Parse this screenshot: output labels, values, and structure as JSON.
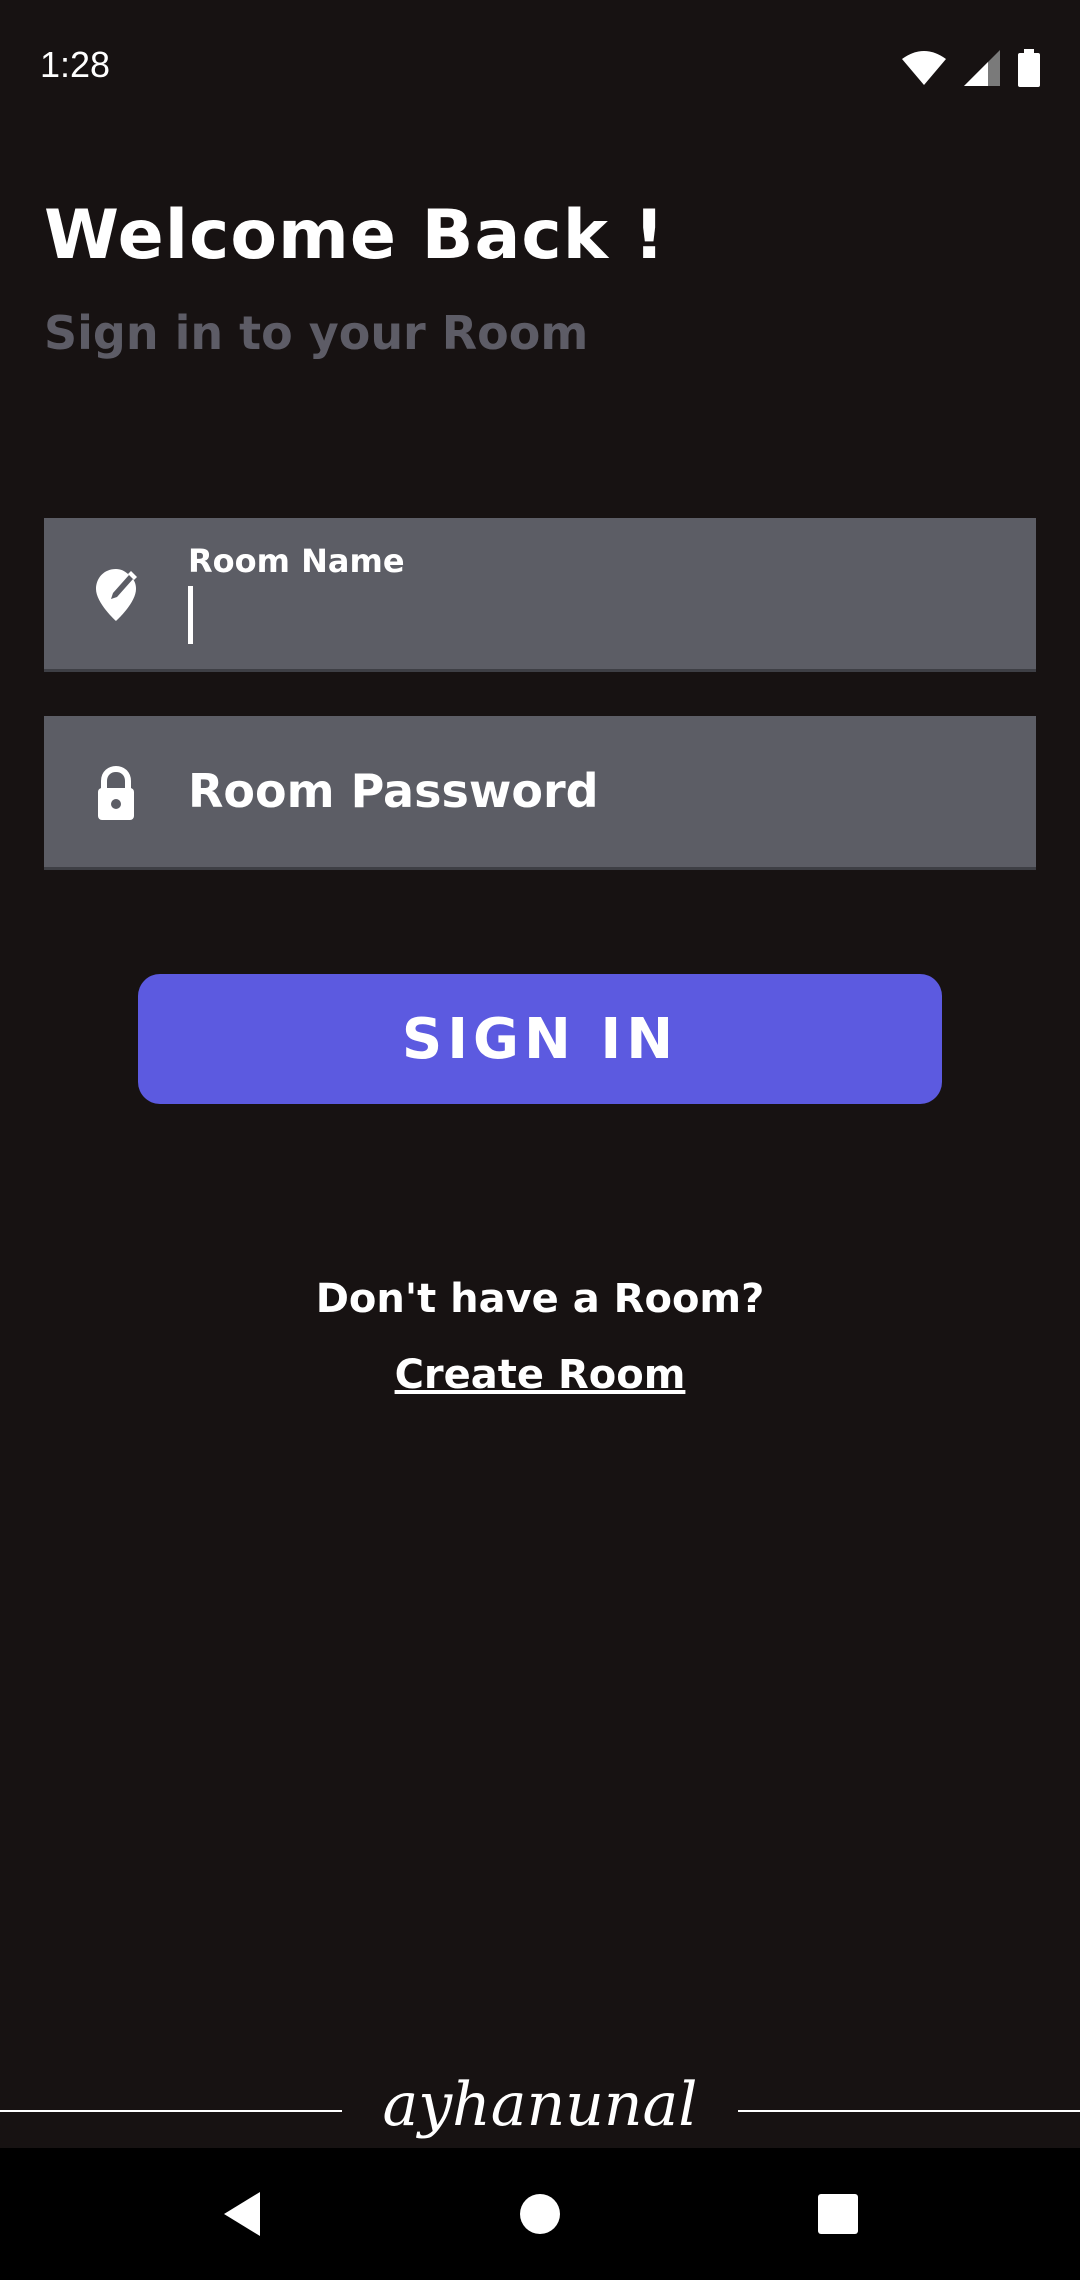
{
  "status_bar": {
    "time": "1:28",
    "icons": [
      "wifi-icon",
      "signal-icon",
      "battery-icon"
    ]
  },
  "header": {
    "title": "Welcome Back !",
    "subtitle": "Sign in to your Room"
  },
  "form": {
    "room_name": {
      "label": "Room Name",
      "value": "",
      "icon": "location-edit-icon"
    },
    "room_password": {
      "placeholder": "Room Password",
      "value": "",
      "icon": "lock-icon"
    },
    "sign_in_label": "SIGN IN"
  },
  "footer_links": {
    "prompt": "Don't have a Room?",
    "create_label": "Create Room"
  },
  "colors": {
    "background": "#171212",
    "field": "#5c5d65",
    "button": "#5c5ae0",
    "subtitle": "#5d5c66"
  },
  "nav_bar": {
    "icons": [
      "back-icon",
      "home-icon",
      "recents-icon"
    ]
  }
}
